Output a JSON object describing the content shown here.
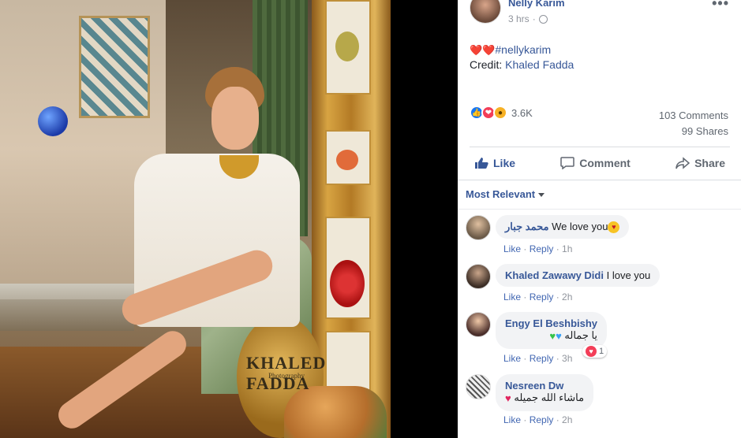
{
  "post": {
    "author": "Nelly Karim",
    "time": "3 hrs",
    "privacy_icon": "globe-icon",
    "caption_emojis": "❤️❤️",
    "caption_hashtag": "#nellykarim",
    "credit_label": "Credit:",
    "credit_name": "Khaled Fadda",
    "photo_watermark": "KHALED FADDA",
    "photo_watermark_sub": "Photography"
  },
  "reactions": {
    "icons": [
      "like-icon",
      "love-icon",
      "wow-icon"
    ],
    "count": "3.6K",
    "comments": "103 Comments",
    "shares": "99 Shares"
  },
  "actions": {
    "like": "Like",
    "comment": "Comment",
    "share": "Share"
  },
  "comments_filter": "Most Relevant",
  "comments": [
    {
      "name": "محمد جبار",
      "text": "We love you",
      "like": "Like",
      "reply": "Reply",
      "time": "1h"
    },
    {
      "name": "Khaled Zawawy Didi",
      "text": "I love you",
      "like": "Like",
      "reply": "Reply",
      "time": "2h"
    },
    {
      "name": "Engy El Beshbishy",
      "text": "يا جماله",
      "like": "Like",
      "reply": "Reply",
      "time": "3h",
      "reaction_count": "1"
    },
    {
      "name": "Nesreen Dw",
      "text": "ماشاء الله جميله",
      "like": "Like",
      "reply": "Reply",
      "time": "2h"
    }
  ],
  "colors": {
    "link": "#385898",
    "like_blue": "#1877f2",
    "love_red": "#f33e58",
    "wow_yellow": "#f7b125"
  }
}
